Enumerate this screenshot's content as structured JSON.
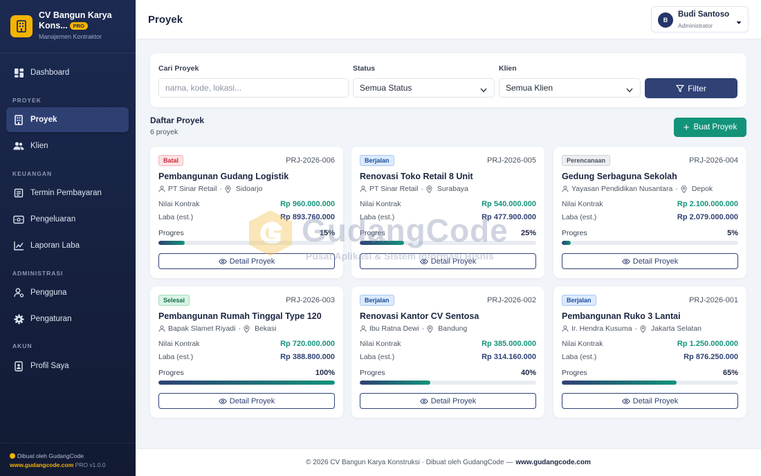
{
  "brand": {
    "name": "CV Bangun Karya Kons...",
    "badge": "PRO",
    "subtitle": "Manajemen Kontraktor"
  },
  "sidebar": {
    "dashboard": "Dashboard",
    "sections": {
      "proyek": "PROYEK",
      "keuangan": "KEUANGAN",
      "administrasi": "ADMINISTRASI",
      "akun": "AKUN"
    },
    "items": {
      "proyek": "Proyek",
      "klien": "Klien",
      "termin": "Termin Pembayaran",
      "pengeluaran": "Pengeluaran",
      "laporan": "Laporan Laba",
      "pengguna": "Pengguna",
      "pengaturan": "Pengaturan",
      "profil": "Profil Saya"
    },
    "footer": {
      "made_by": "Dibuat oleh GudangCode",
      "site": "www.gudangcode.com",
      "version": "PRO v1.0.0"
    }
  },
  "header": {
    "title": "Proyek",
    "user": {
      "initial": "B",
      "name": "Budi Santoso",
      "role": "Administrator"
    }
  },
  "filters": {
    "search_label": "Cari Proyek",
    "search_placeholder": "nama, kode, lokasi...",
    "search_value": "",
    "status_label": "Status",
    "status_value": "Semua Status",
    "client_label": "Klien",
    "client_value": "Semua Klien",
    "filter_button": "Filter"
  },
  "list": {
    "title": "Daftar Proyek",
    "count": "6 proyek",
    "create_button": "Buat Proyek"
  },
  "labels": {
    "contract": "Nilai Kontrak",
    "profit": "Laba (est.)",
    "progress": "Progres",
    "detail": "Detail Proyek"
  },
  "projects": [
    {
      "status": "Batal",
      "status_key": "batal",
      "code": "PRJ-2026-006",
      "title": "Pembangunan Gudang Logistik",
      "client": "PT Sinar Retail",
      "location": "Sidoarjo",
      "contract": "Rp 960.000.000",
      "profit": "Rp 893.760.000",
      "progress": 15,
      "progress_text": "15%"
    },
    {
      "status": "Berjalan",
      "status_key": "berjalan",
      "code": "PRJ-2026-005",
      "title": "Renovasi Toko Retail 8 Unit",
      "client": "PT Sinar Retail",
      "location": "Surabaya",
      "contract": "Rp 540.000.000",
      "profit": "Rp 477.900.000",
      "progress": 25,
      "progress_text": "25%"
    },
    {
      "status": "Perencanaan",
      "status_key": "perencanaan",
      "code": "PRJ-2026-004",
      "title": "Gedung Serbaguna Sekolah",
      "client": "Yayasan Pendidikan Nusantara",
      "location": "Depok",
      "contract": "Rp 2.100.000.000",
      "profit": "Rp 2.079.000.000",
      "progress": 5,
      "progress_text": "5%"
    },
    {
      "status": "Selesai",
      "status_key": "selesai",
      "code": "PRJ-2026-003",
      "title": "Pembangunan Rumah Tinggal Type 120",
      "client": "Bapak Slamet Riyadi",
      "location": "Bekasi",
      "contract": "Rp 720.000.000",
      "profit": "Rp 388.800.000",
      "progress": 100,
      "progress_text": "100%"
    },
    {
      "status": "Berjalan",
      "status_key": "berjalan",
      "code": "PRJ-2026-002",
      "title": "Renovasi Kantor CV Sentosa",
      "client": "Ibu Ratna Dewi",
      "location": "Bandung",
      "contract": "Rp 385.000.000",
      "profit": "Rp 314.160.000",
      "progress": 40,
      "progress_text": "40%"
    },
    {
      "status": "Berjalan",
      "status_key": "berjalan",
      "code": "PRJ-2026-001",
      "title": "Pembangunan Ruko 3 Lantai",
      "client": "Ir. Hendra Kusuma",
      "location": "Jakarta Selatan",
      "contract": "Rp 1.250.000.000",
      "profit": "Rp 876.250.000",
      "progress": 65,
      "progress_text": "65%"
    }
  ],
  "footer": {
    "text": "© 2026 CV Bangun Karya Konstruksi · Dibuat oleh GudangCode —",
    "link": "www.gudangcode.com"
  },
  "watermark": {
    "name": "GudangCode",
    "tagline": "Pusat Aplikasi & Sistem Informasi Bisnis"
  },
  "colors": {
    "sidebar_bg": "#1c2a52",
    "primary": "#2f4175",
    "accent_green": "#13937a",
    "brand_yellow": "#f4b400"
  },
  "icons": {
    "logo": "building-icon",
    "dashboard": "grid-icon",
    "proyek": "building-icon",
    "klien": "users-icon",
    "termin": "receipt-icon",
    "pengeluaran": "wallet-icon",
    "laporan": "line-chart-icon",
    "pengguna": "user-gear-icon",
    "pengaturan": "gear-icon",
    "profil": "id-badge-icon",
    "filter": "funnel-icon",
    "detail": "eye-icon"
  }
}
